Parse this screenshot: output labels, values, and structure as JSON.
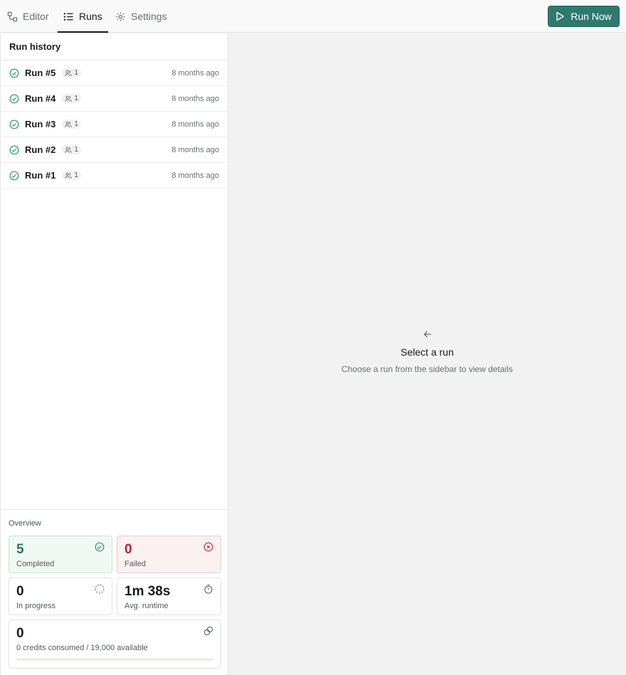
{
  "tabs": [
    {
      "label": "Editor",
      "icon": "workflow-icon",
      "active": false
    },
    {
      "label": "Runs",
      "icon": "list-icon",
      "active": true
    },
    {
      "label": "Settings",
      "icon": "gear-icon",
      "active": false
    }
  ],
  "actions": {
    "run_now_label": "Run Now",
    "run_now_icon": "play-icon"
  },
  "sidebar": {
    "title": "Run history",
    "runs": [
      {
        "name": "Run #5",
        "participants": "1",
        "time": "8 months ago",
        "status": "completed"
      },
      {
        "name": "Run #4",
        "participants": "1",
        "time": "8 months ago",
        "status": "completed"
      },
      {
        "name": "Run #3",
        "participants": "1",
        "time": "8 months ago",
        "status": "completed"
      },
      {
        "name": "Run #2",
        "participants": "1",
        "time": "8 months ago",
        "status": "completed"
      },
      {
        "name": "Run #1",
        "participants": "1",
        "time": "8 months ago",
        "status": "completed"
      }
    ]
  },
  "overview": {
    "title": "Overview",
    "completed": {
      "value": "5",
      "label": "Completed"
    },
    "failed": {
      "value": "0",
      "label": "Failed"
    },
    "in_progress": {
      "value": "0",
      "label": "In progress"
    },
    "avg_runtime": {
      "value": "1m 38s",
      "label": "Avg. runtime"
    },
    "credits": {
      "value": "0",
      "label": "0 credits consumed / 19,000 available",
      "used_fraction": 0
    }
  },
  "empty_state": {
    "title": "Select a run",
    "subtitle": "Choose a run from the sidebar to view details"
  },
  "colors": {
    "accent": "#2e7a6e",
    "success": "#2e9a6a",
    "danger": "#c0334b"
  }
}
